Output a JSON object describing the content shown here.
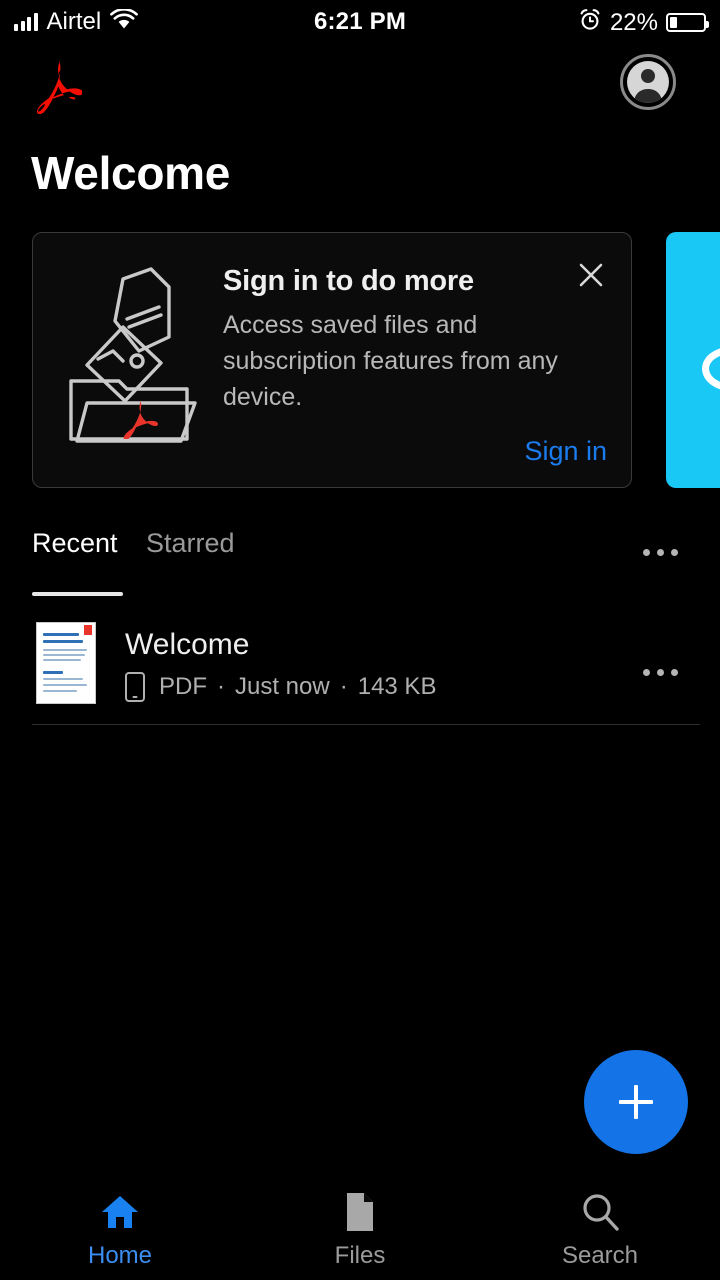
{
  "status_bar": {
    "carrier": "Airtel",
    "signal_icon": "signal-bars-icon",
    "wifi_icon": "wifi-icon",
    "time": "6:21 PM",
    "alarm_icon": "alarm-clock-icon",
    "battery_percent": "22%",
    "battery_level": 22,
    "battery_icon": "battery-icon"
  },
  "app_bar": {
    "logo_icon": "adobe-acrobat-logo",
    "avatar_icon": "user-avatar-icon",
    "logo_color": "#f40f02"
  },
  "page_title": "Welcome",
  "signin_card": {
    "illustration_icon": "documents-into-folder-illustration",
    "title": "Sign in to do more",
    "body": "Access saved files and subscription features from any device.",
    "close_icon": "close-icon",
    "cta_label": "Sign in",
    "cta_color": "#1b7ced"
  },
  "promo_card": {
    "background_color": "#19c8f5",
    "glyph_icon": "partial-white-glyph-icon"
  },
  "tabs": {
    "items": [
      {
        "label": "Recent",
        "active": true
      },
      {
        "label": "Starred",
        "active": false
      }
    ],
    "overflow_icon": "more-options-icon"
  },
  "files": {
    "rows": [
      {
        "thumbnail_icon": "pdf-page-thumbnail",
        "name": "Welcome",
        "device_icon": "phone-icon",
        "type": "PDF",
        "separator_1": "·",
        "modified": "Just now",
        "separator_2": "·",
        "size": "143 KB",
        "overflow_icon": "more-options-icon"
      }
    ]
  },
  "fab": {
    "icon": "plus-icon",
    "color": "#1473e6"
  },
  "bottom_nav": {
    "items": [
      {
        "label": "Home",
        "icon": "home-icon",
        "active": true
      },
      {
        "label": "Files",
        "icon": "file-icon",
        "active": false
      },
      {
        "label": "Search",
        "icon": "search-icon",
        "active": false
      }
    ],
    "active_color": "#3b8ef0"
  }
}
